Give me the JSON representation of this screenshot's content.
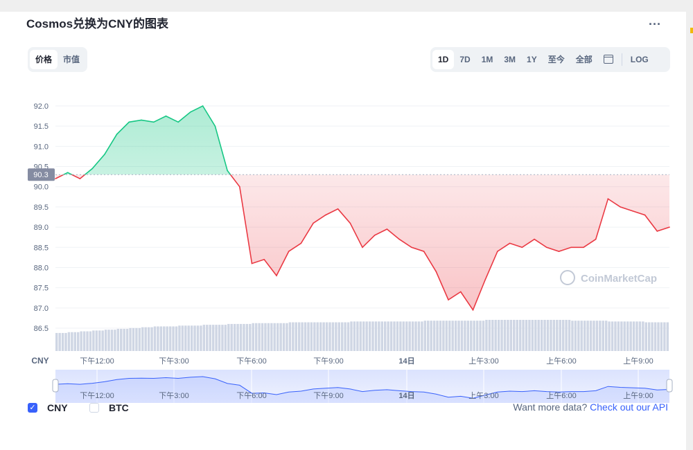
{
  "title": "Cosmos兑换为CNY的图表",
  "more_label": "...",
  "view_tabs": [
    {
      "label": "价格",
      "active": true
    },
    {
      "label": "市值",
      "active": false
    }
  ],
  "range_tabs": [
    {
      "label": "1D",
      "active": true
    },
    {
      "label": "7D",
      "active": false
    },
    {
      "label": "1M",
      "active": false
    },
    {
      "label": "3M",
      "active": false
    },
    {
      "label": "1Y",
      "active": false
    },
    {
      "label": "至今",
      "active": false
    },
    {
      "label": "全部",
      "active": false
    }
  ],
  "calendar_icon": "calendar-icon",
  "log_label": "LOG",
  "watermark": "CoinMarketCap",
  "currency_label": "CNY",
  "checkboxes": [
    {
      "label": "CNY",
      "checked": true
    },
    {
      "label": "BTC",
      "checked": false
    }
  ],
  "api_prompt": "Want more data?",
  "api_link": "Check out our API",
  "colors": {
    "up": "#16c784",
    "down": "#ea3943",
    "accent": "#3861fb",
    "volume": "#cfd6e4"
  },
  "chart_data": {
    "type": "area",
    "title": "Cosmos兑换为CNY的图表",
    "xlabel": "",
    "ylabel": "CNY",
    "baseline": 90.3,
    "baseline_label": "90.3",
    "ylim": [
      86.5,
      92.0
    ],
    "yticks": [
      "92.0",
      "91.5",
      "91.0",
      "90.5",
      "90.0",
      "89.5",
      "89.0",
      "88.5",
      "88.0",
      "87.5",
      "87.0",
      "86.5"
    ],
    "xticks": [
      "下午12:00",
      "下午3:00",
      "下午6:00",
      "下午9:00",
      "14日",
      "上午3:00",
      "上午6:00",
      "上午9:00"
    ],
    "grid": true,
    "series": [
      {
        "x": [
          0,
          0.02,
          0.04,
          0.06,
          0.08,
          0.1,
          0.12,
          0.14,
          0.16,
          0.18,
          0.2,
          0.22,
          0.24,
          0.26,
          0.28,
          0.3,
          0.32,
          0.34,
          0.36,
          0.38,
          0.4,
          0.42,
          0.44,
          0.46,
          0.48,
          0.5,
          0.52,
          0.54,
          0.56,
          0.58,
          0.6,
          0.62,
          0.64,
          0.66,
          0.68,
          0.7,
          0.72,
          0.74,
          0.76,
          0.78,
          0.8,
          0.82,
          0.84,
          0.86,
          0.88,
          0.9,
          0.92,
          0.94,
          0.96,
          0.98,
          1.0
        ],
        "values": [
          90.2,
          90.35,
          90.2,
          90.45,
          90.8,
          91.3,
          91.6,
          91.65,
          91.6,
          91.75,
          91.6,
          91.85,
          92.0,
          91.5,
          90.4,
          90.0,
          88.1,
          88.2,
          87.8,
          88.4,
          88.6,
          89.1,
          89.3,
          89.45,
          89.1,
          88.5,
          88.8,
          88.95,
          88.7,
          88.5,
          88.4,
          87.9,
          87.2,
          87.4,
          86.95,
          87.7,
          88.4,
          88.6,
          88.5,
          88.7,
          88.5,
          88.4,
          88.5,
          88.5,
          88.7,
          89.7,
          89.5,
          89.4,
          89.3,
          88.9,
          89.0
        ]
      }
    ],
    "volume": [
      0.22,
      0.23,
      0.24,
      0.25,
      0.26,
      0.27,
      0.28,
      0.29,
      0.3,
      0.3,
      0.31,
      0.31,
      0.32,
      0.32,
      0.33,
      0.33,
      0.34,
      0.34,
      0.34,
      0.35,
      0.35,
      0.35,
      0.35,
      0.35,
      0.36,
      0.36,
      0.36,
      0.36,
      0.36,
      0.36,
      0.37,
      0.37,
      0.37,
      0.37,
      0.37,
      0.38,
      0.38,
      0.38,
      0.38,
      0.38,
      0.38,
      0.38,
      0.37,
      0.37,
      0.37,
      0.36,
      0.36,
      0.36,
      0.35,
      0.35
    ]
  }
}
